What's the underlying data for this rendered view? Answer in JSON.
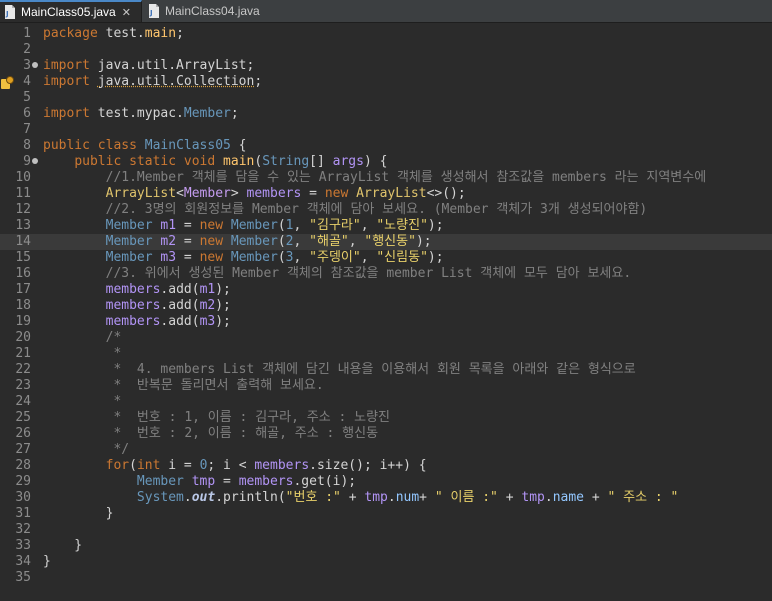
{
  "tabs": [
    {
      "label": "MainClass05.java",
      "active": true,
      "close": "✕"
    },
    {
      "label": "MainClass04.java",
      "active": false
    }
  ],
  "colors": {
    "background": "#2b2b2b",
    "keyword": "#cc7832",
    "string": "#e8d06a",
    "comment": "#808080"
  },
  "editor": {
    "current_line": 14,
    "lines": [
      {
        "n": "1",
        "t": "package test.main;"
      },
      {
        "n": "2",
        "t": ""
      },
      {
        "n": "3",
        "t": "import java.util.ArrayList;"
      },
      {
        "n": "4",
        "t": "import java.util.Collection;"
      },
      {
        "n": "5",
        "t": ""
      },
      {
        "n": "6",
        "t": "import test.mypac.Member;"
      },
      {
        "n": "7",
        "t": ""
      },
      {
        "n": "8",
        "t": "public class MainClass05 {"
      },
      {
        "n": "9",
        "t": "    public static void main(String[] args) {"
      },
      {
        "n": "10",
        "t": "        //1.Member 객체를 담을 수 있는 ArrayList 객체를 생성해서 참조값을 members 라는 지역변수에"
      },
      {
        "n": "11",
        "t": "        ArrayList<Member> members = new ArrayList<>();"
      },
      {
        "n": "12",
        "t": "        //2. 3명의 회원정보를 Member 객체에 담아 보세요. (Member 객체가 3개 생성되어야함)"
      },
      {
        "n": "13",
        "t": "        Member m1 = new Member(1, \"김구라\", \"노량진\");"
      },
      {
        "n": "14",
        "t": "        Member m2 = new Member(2, \"해골\", \"행신동\");"
      },
      {
        "n": "15",
        "t": "        Member m3 = new Member(3, \"주뎅이\", \"신림동\");"
      },
      {
        "n": "16",
        "t": "        //3. 위에서 생성된 Member 객체의 참조값을 member List 객체에 모두 담아 보세요."
      },
      {
        "n": "17",
        "t": "        members.add(m1);"
      },
      {
        "n": "18",
        "t": "        members.add(m2);"
      },
      {
        "n": "19",
        "t": "        members.add(m3);"
      },
      {
        "n": "20",
        "t": "        /*"
      },
      {
        "n": "21",
        "t": "         *"
      },
      {
        "n": "22",
        "t": "         *  4. members List 객체에 담긴 내용을 이용해서 회원 목록을 아래와 같은 형식으로"
      },
      {
        "n": "23",
        "t": "         *  반복문 돌리면서 출력해 보세요."
      },
      {
        "n": "24",
        "t": "         *"
      },
      {
        "n": "25",
        "t": "         *  번호 : 1, 이름 : 김구라, 주소 : 노량진"
      },
      {
        "n": "26",
        "t": "         *  번호 : 2, 이름 : 해골, 주소 : 행신동"
      },
      {
        "n": "27",
        "t": "         */"
      },
      {
        "n": "28",
        "t": "        for(int i = 0; i < members.size(); i++) {"
      },
      {
        "n": "29",
        "t": "            Member tmp = members.get(i);"
      },
      {
        "n": "30",
        "t": "            System.out.println(\"번호 :\" + tmp.num+ \" 이름 :\" + tmp.name + \" 주소 : \""
      },
      {
        "n": "31",
        "t": "        }"
      },
      {
        "n": "32",
        "t": ""
      },
      {
        "n": "33",
        "t": "    }"
      },
      {
        "n": "34",
        "t": "}"
      },
      {
        "n": "35",
        "t": ""
      }
    ]
  }
}
